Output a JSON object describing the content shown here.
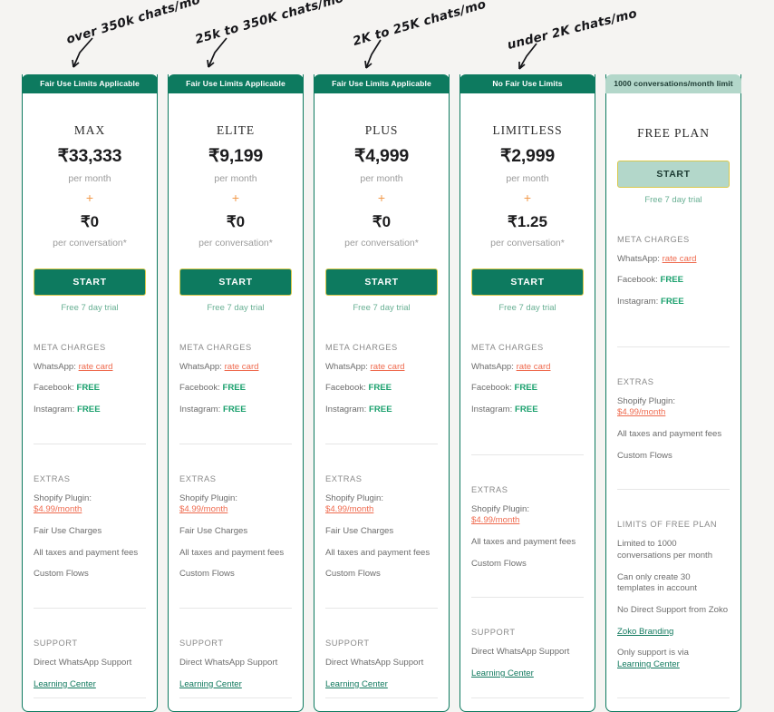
{
  "page": {
    "background_color": "#f5f4f2",
    "brand_green": "#0d7a5f",
    "accent_orange": "#ef6a4e",
    "free_plan_green": "#b3d7ca",
    "btn_border_yellow": "#d9c84a"
  },
  "annotations": [
    {
      "text": "over 350k chats/mo"
    },
    {
      "text": "25k to 350K chats/mo"
    },
    {
      "text": "2K to 25K chats/mo"
    },
    {
      "text": "under 2K chats/mo"
    }
  ],
  "labels": {
    "per_month": "per month",
    "per_conversation": "per conversation*",
    "plus": "+",
    "start": "START",
    "trial": "Free 7 day trial",
    "meta_charges": "META CHARGES",
    "extras": "EXTRAS",
    "support": "SUPPORT",
    "limits_of_free_plan": "LIMITS OF FREE PLAN",
    "whatsapp": "WhatsApp:",
    "facebook": "Facebook:",
    "instagram": "Instagram:",
    "rate_card": "rate card",
    "free_value": "FREE",
    "shopify_plugin": "Shopify Plugin:",
    "shopify_price": "$4.99/month",
    "fair_use_charges": "Fair Use Charges",
    "all_taxes": "All taxes and payment fees",
    "custom_flows": "Custom Flows",
    "direct_support": "Direct WhatsApp Support",
    "learning_center": "Learning Center"
  },
  "plans": [
    {
      "badge": "Fair Use Limits Applicable",
      "name": "MAX",
      "price_month": "₹33,333",
      "price_conversation": "₹0",
      "has_fair_use_charges": true,
      "is_free": false
    },
    {
      "badge": "Fair Use Limits Applicable",
      "name": "ELITE",
      "price_month": "₹9,199",
      "price_conversation": "₹0",
      "has_fair_use_charges": true,
      "is_free": false
    },
    {
      "badge": "Fair Use Limits Applicable",
      "name": "PLUS",
      "price_month": "₹4,999",
      "price_conversation": "₹0",
      "has_fair_use_charges": true,
      "is_free": false
    },
    {
      "badge": "No Fair Use Limits",
      "name": "LIMITLESS",
      "price_month": "₹2,999",
      "price_conversation": "₹1.25",
      "has_fair_use_charges": false,
      "is_free": false
    }
  ],
  "free_plan": {
    "badge": "1000 conversations/month limit",
    "name": "FREE PLAN",
    "limits": [
      "Limited to 1000 conversations per month",
      "Can only create 30 templates in account",
      "No Direct Support from Zoko"
    ],
    "branding_link": "Zoko Branding",
    "support_prefix": "Only support is via",
    "support_link": "Learning Center"
  }
}
